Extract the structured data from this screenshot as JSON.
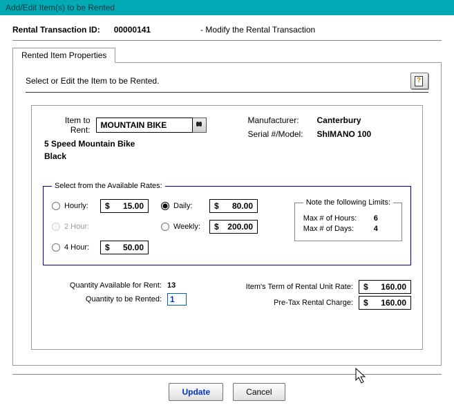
{
  "window": {
    "title": "Add/Edit Item(s) to be Rented"
  },
  "header": {
    "label": "Rental Transaction ID:",
    "id": "00000141",
    "mode": "- Modify the Rental Transaction"
  },
  "tab": {
    "label": "Rented Item Properties"
  },
  "instruction": "Select or Edit the Item to be Rented.",
  "item": {
    "item_label": "Item to Rent:",
    "item_value": "MOUNTAIN BIKE",
    "desc": "5 Speed Mountain Bike",
    "color": "Black",
    "mfr_label": "Manufacturer:",
    "mfr_value": "Canterbury",
    "serial_label": "Serial #/Model:",
    "serial_value": "ShIMANO 100"
  },
  "rates": {
    "legend": "Select from the Available Rates:",
    "options": {
      "hourly": {
        "label": "Hourly:",
        "sym": "$",
        "amount": "15.00",
        "selected": false,
        "enabled": true
      },
      "two_hour": {
        "label": "2 Hour:",
        "sym": "$",
        "amount": "",
        "selected": false,
        "enabled": false
      },
      "four_hour": {
        "label": "4 Hour:",
        "sym": "$",
        "amount": "50.00",
        "selected": false,
        "enabled": true
      },
      "daily": {
        "label": "Daily:",
        "sym": "$",
        "amount": "80.00",
        "selected": true,
        "enabled": true
      },
      "weekly": {
        "label": "Weekly:",
        "sym": "$",
        "amount": "200.00",
        "selected": false,
        "enabled": true
      }
    },
    "limits": {
      "legend": "Note the following Limits:",
      "max_hours_label": "Max # of Hours:",
      "max_hours": "6",
      "max_days_label": "Max # of Days:",
      "max_days": "4"
    }
  },
  "quantity": {
    "avail_label": "Quantity Available for Rent:",
    "avail_value": "13",
    "to_rent_label": "Quantity to be Rented:",
    "to_rent_value": "1"
  },
  "charges": {
    "unit_label": "Item's Term of Rental Unit Rate:",
    "unit_sym": "$",
    "unit_amount": "160.00",
    "pretax_label": "Pre-Tax Rental Charge:",
    "pretax_sym": "$",
    "pretax_amount": "160.00"
  },
  "buttons": {
    "update": "Update",
    "cancel": "Cancel"
  }
}
